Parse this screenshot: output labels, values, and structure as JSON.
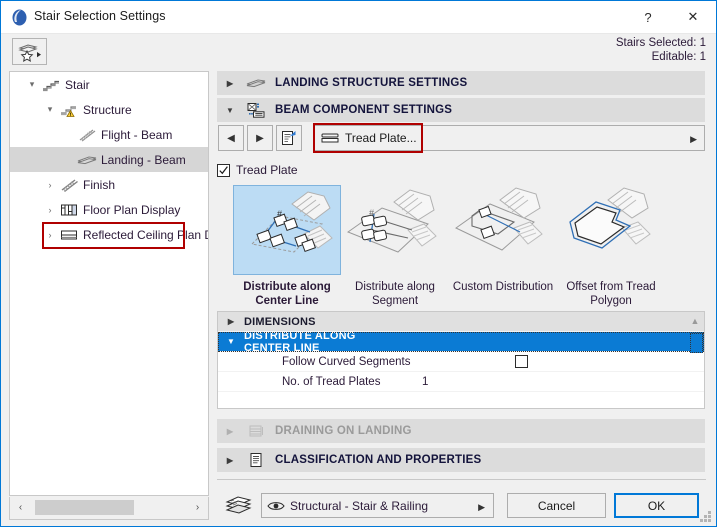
{
  "window": {
    "title": "Stair Selection Settings",
    "app_icon": "archicad-stair-icon",
    "help_label": "?",
    "close_label": "✕",
    "accent_color": "#0078d7",
    "highlight_color": "#b00000"
  },
  "subheader": {
    "favorites_icon": "favorites-star-icon",
    "stairs_selected": "Stairs Selected: 1",
    "editable": "Editable: 1"
  },
  "tree": {
    "items": [
      {
        "label": "Stair",
        "icon": "stair-icon",
        "twisty": "▾",
        "depth": 0,
        "selected": false
      },
      {
        "label": "Structure",
        "icon": "structure-warning-icon",
        "twisty": "▾",
        "depth": 1,
        "selected": false
      },
      {
        "label": "Flight - Beam",
        "icon": "flight-beam-icon",
        "twisty": "",
        "depth": 2,
        "selected": false
      },
      {
        "label": "Landing - Beam",
        "icon": "landing-beam-icon",
        "twisty": "",
        "depth": 2,
        "selected": true
      },
      {
        "label": "Finish",
        "icon": "finish-icon",
        "twisty": "›",
        "depth": 1,
        "selected": false
      },
      {
        "label": "Floor Plan Display",
        "icon": "floor-plan-display-icon",
        "twisty": "›",
        "depth": 1,
        "selected": false
      },
      {
        "label": "Reflected Ceiling Plan Di",
        "icon": "reflected-ceiling-icon",
        "twisty": "›",
        "depth": 1,
        "selected": false
      }
    ],
    "hscroll": {
      "left_arrow": "‹",
      "right_arrow": "›"
    }
  },
  "sections": {
    "landing_structure": {
      "label": "LANDING STRUCTURE SETTINGS",
      "twisty": "▶",
      "icon": "landing-beam-icon",
      "expanded": false,
      "disabled": false
    },
    "beam_component": {
      "label": "BEAM COMPONENT SETTINGS",
      "twisty": "▼",
      "icon": "beam-component-icon",
      "expanded": true,
      "disabled": false
    },
    "draining": {
      "label": "DRAINING ON LANDING",
      "twisty": "▶",
      "icon": "draining-icon",
      "expanded": false,
      "disabled": true
    },
    "classification": {
      "label": "CLASSIFICATION AND PROPERTIES",
      "twisty": "▶",
      "icon": "classification-icon",
      "expanded": false,
      "disabled": false
    }
  },
  "nav": {
    "prev_icon": "◀",
    "next_icon": "▶",
    "edit_icon": "edit-component-icon",
    "component_name": "Tread Plate...",
    "component_icon": "tread-plate-icon",
    "dropdown_arrow": "▶"
  },
  "tread_plate": {
    "checkbox_label": "Tread Plate",
    "checked": true
  },
  "distribution_options": [
    {
      "label": "Distribute along\nCenter Line",
      "thumb": "distribute-center-line-thumb",
      "selected": true
    },
    {
      "label": "Distribute along\nSegment",
      "thumb": "distribute-segment-thumb",
      "selected": false
    },
    {
      "label": "Custom Distribution",
      "thumb": "custom-distribution-thumb",
      "selected": false
    },
    {
      "label": "Offset from Tread\nPolygon",
      "thumb": "offset-tread-polygon-thumb",
      "selected": false
    }
  ],
  "parameters": {
    "rows": [
      {
        "type": "header",
        "twisty": "▶",
        "label": "DIMENSIONS",
        "active": false
      },
      {
        "type": "header",
        "twisty": "▼",
        "label": "DISTRIBUTE ALONG CENTER LINE",
        "active": true
      },
      {
        "type": "check",
        "twisty": "",
        "label": "Follow Curved Segments",
        "value": "",
        "checked": false
      },
      {
        "type": "value",
        "twisty": "",
        "label": "No. of Tread Plates",
        "value": "1"
      }
    ],
    "scroll_up_arrow": "▲"
  },
  "footer": {
    "layer_icon": "layers-icon",
    "layer_eye_icon": "eye-icon",
    "layer_value": "Structural - Stair & Railing",
    "layer_arrow": "▶",
    "cancel_label": "Cancel",
    "ok_label": "OK",
    "resize_grip": "resize-grip-icon"
  }
}
